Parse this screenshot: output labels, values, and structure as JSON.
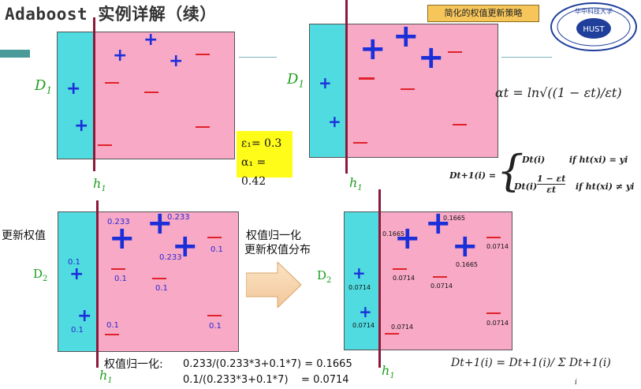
{
  "slide": {
    "title_latin": "Adaboost",
    "title_cn": "实例详解（续）",
    "tag": "简化的权值更新策略",
    "logo_text": "华中科技大学"
  },
  "panel_top_left": {
    "d_label": "D",
    "d_sub": "1",
    "h_label": "h",
    "h_sub": "1",
    "plus_glyph": "+",
    "minus_glyph": "—"
  },
  "panel_top_right": {
    "d_label": "D",
    "d_sub": "1",
    "h_label": "h",
    "h_sub": "1"
  },
  "epsilon_box": {
    "line1": "ε₁= 0.3",
    "line2": "α₁ = 0.42"
  },
  "formulas": {
    "alpha": "αt = ln√((1 − εt)/εt)",
    "d_update_left": "Dt+1(i) =",
    "d_update_case1": "Dt(i)        if ht(xi) = yi",
    "d_update_case2_a": "Dt(i)",
    "d_update_case2_frac_num": "1 − εt",
    "d_update_case2_frac_den": "εt",
    "d_update_case2_cond": "if ht(xi) ≠ yi",
    "normalize": "Dt+1(i) = Dt+1(i)/ Σ Dt+1(i)",
    "normalize_sub": "i"
  },
  "panel_bottom_left": {
    "side_label": "更新权值",
    "d_label": "D",
    "d_sub": "2",
    "h_label": "h",
    "h_sub": "1",
    "w_plus_1": "0.233",
    "w_plus_2": "0.233",
    "w_plus_3": "0.233",
    "w_minus_1": "0.1",
    "w_minus_2": "0.1",
    "w_minus_3": "0.1",
    "w_plus_left1": "0.1",
    "w_plus_left2": "0.1",
    "w_minus_bottom": "0.1",
    "w_minus_br": "0.1"
  },
  "middle": {
    "line1": "权值归一化",
    "line2": "更新权值分布"
  },
  "panel_bottom_right": {
    "d_label": "D",
    "d_sub": "2",
    "h_label": "h",
    "h_sub": "1",
    "w_top_plus1": "0.1665",
    "w_top_plus2": "0.1665",
    "w_top_plus3": "0.1665",
    "w_m1": "0.0714",
    "w_m2": "0.0714",
    "w_m3": "0.0714",
    "w_m4": "0.0714",
    "w_m5": "0.0714",
    "w_p_left1": "0.0714",
    "w_p_left2": "0.0714"
  },
  "normalization": {
    "label": "权值归一化:",
    "calc1": "0.233/(0.233*3+0.1*7) = 0.1665",
    "calc2": "0.1/(0.233*3+0.1*7)    = 0.0714"
  }
}
